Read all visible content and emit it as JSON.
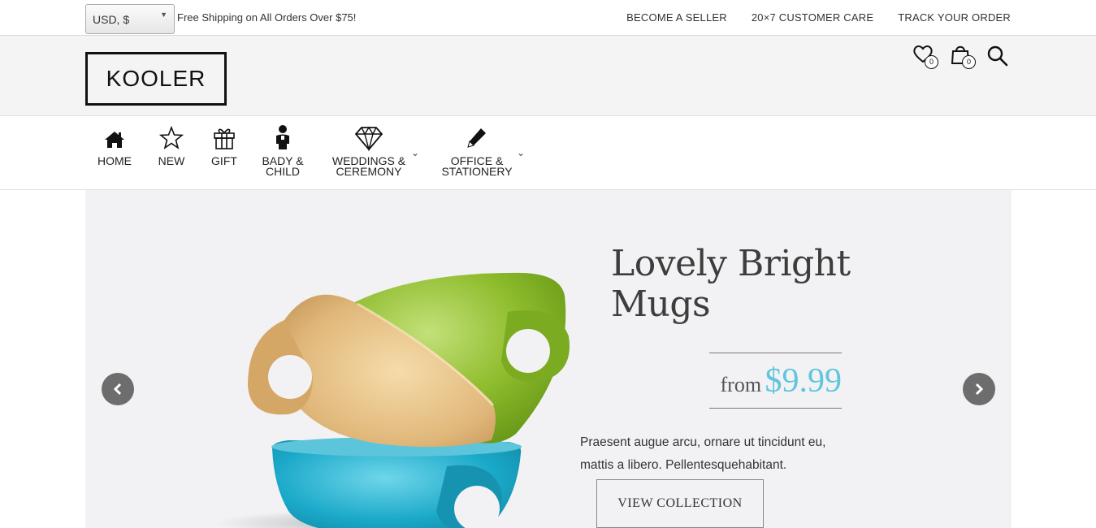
{
  "topbar": {
    "currency": "USD, $",
    "shipping_text": "Free Shipping on All Orders Over $75!",
    "links": [
      "BECOME A SELLER",
      "20×7 CUSTOMER CARE",
      "TRACK YOUR ORDER"
    ]
  },
  "header": {
    "logo": "KOOLER",
    "wishlist_count": "0",
    "cart_count": "0"
  },
  "nav": {
    "items": [
      {
        "label": "HOME",
        "icon": "home-icon"
      },
      {
        "label": "NEW",
        "icon": "star-icon"
      },
      {
        "label": "GIFT",
        "icon": "gift-icon"
      },
      {
        "label": "BADY &",
        "label2": "CHILD",
        "icon": "child-icon"
      },
      {
        "label": "WEDDINGS &",
        "label2": "CEREMONY",
        "icon": "diamond-icon"
      },
      {
        "label": "OFFICE &",
        "label2": "STATIONERY",
        "icon": "pencil-icon"
      }
    ]
  },
  "hero": {
    "title_line1": "Lovely Bright",
    "title_line2": "Mugs",
    "price_from": "from",
    "price_value": "$9.99",
    "description_line1": "Praesent augue arcu, ornare ut tincidunt eu,",
    "description_line2": "mattis a libero. Pellentesquehabitant.",
    "cta_label": "VIEW COLLECTION",
    "colors": {
      "accent": "#5fc6dd",
      "mug_tan": "#d9b27a",
      "mug_green": "#8fbd2e",
      "mug_blue": "#1ba9c9"
    }
  }
}
